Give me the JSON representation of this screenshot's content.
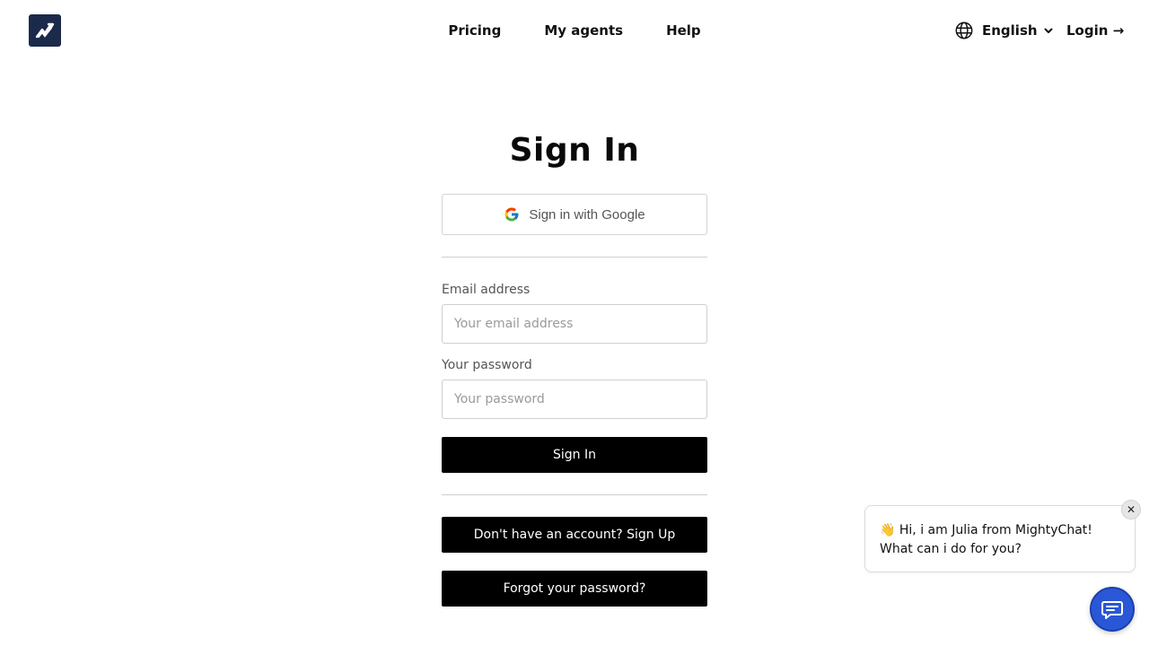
{
  "header": {
    "logo_icon": "logo-chart-icon",
    "nav": [
      "Pricing",
      "My agents",
      "Help"
    ],
    "language": "English",
    "login": "Login →"
  },
  "form": {
    "title": "Sign In",
    "google_button": "Sign in with Google",
    "email_label": "Email address",
    "email_placeholder": "Your email address",
    "email_value": "",
    "password_label": "Your password",
    "password_placeholder": "Your password",
    "password_value": "",
    "submit": "Sign In",
    "signup": "Don't have an account? Sign Up",
    "forgot": "Forgot your password?"
  },
  "chat": {
    "message_line1": "👋 Hi, i am Julia from MightyChat!",
    "message_line2": "What can i do for you?",
    "close_label": "✕",
    "launcher_icon": "chat-bubble-icon",
    "accent_color": "#2a57d6"
  },
  "colors": {
    "brand_dark": "#1b2a4a",
    "primary_button": "#000000"
  }
}
